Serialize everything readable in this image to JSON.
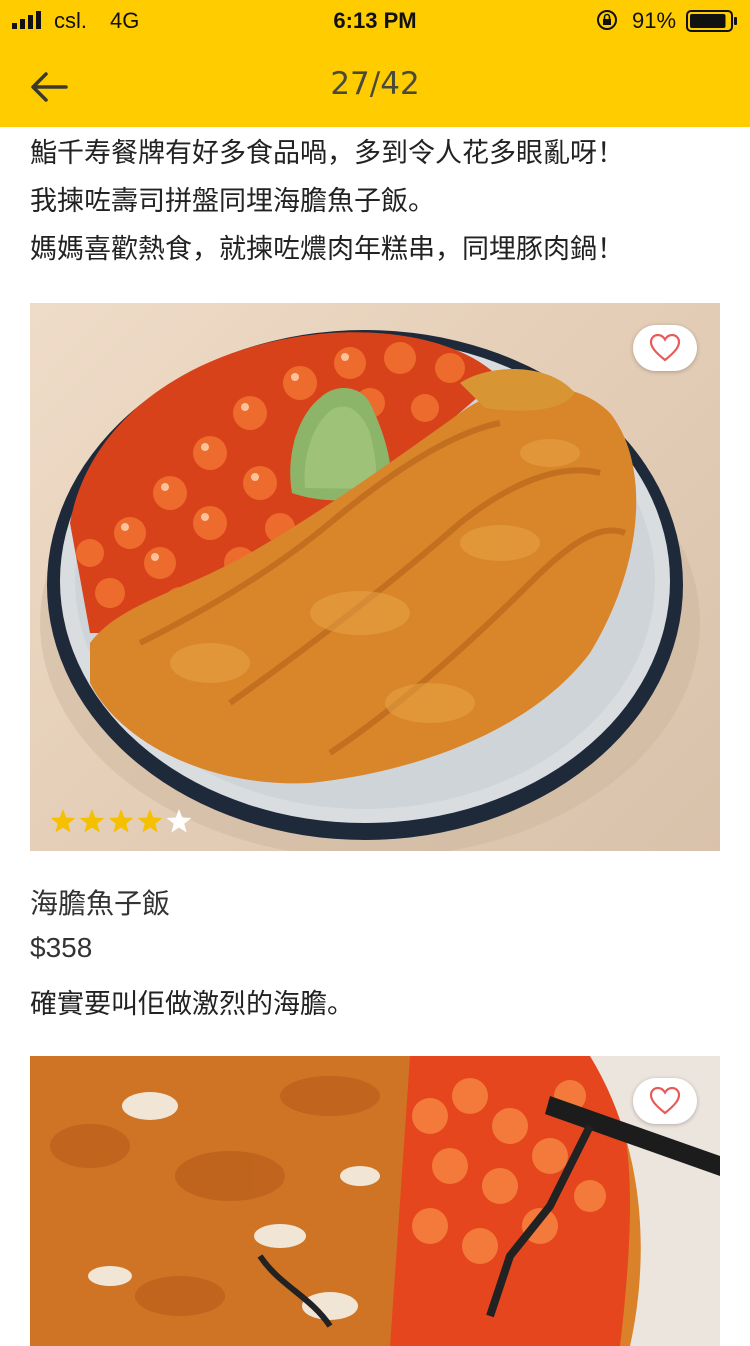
{
  "status_bar": {
    "carrier": "csl.",
    "network": "4G",
    "time": "6:13 PM",
    "battery_percent": "91%",
    "battery_level": 0.91
  },
  "nav": {
    "page_counter": "27/42"
  },
  "intro": {
    "lines": [
      "鮨千寿餐牌有好多食品喎，多到令人花多眼亂呀！",
      "我揀咗壽司拼盤同埋海膽魚子飯。",
      "媽媽喜歡熱食，就揀咗燶肉年糕串，同埋豚肉鍋！"
    ]
  },
  "dish": {
    "rating": 4,
    "rating_max": 5,
    "name": "海膽魚子飯",
    "price": "$358",
    "description": "確實要叫佢做激烈的海膽。"
  },
  "colors": {
    "header_bg": "#ffcc00",
    "star_filled": "#f5c000",
    "star_empty": "#ffffff",
    "heart_outline": "#e85a5a"
  },
  "icons": [
    "back-arrow-icon",
    "heart-icon",
    "star-icon",
    "signal-icon",
    "orientation-lock-icon",
    "battery-icon"
  ]
}
